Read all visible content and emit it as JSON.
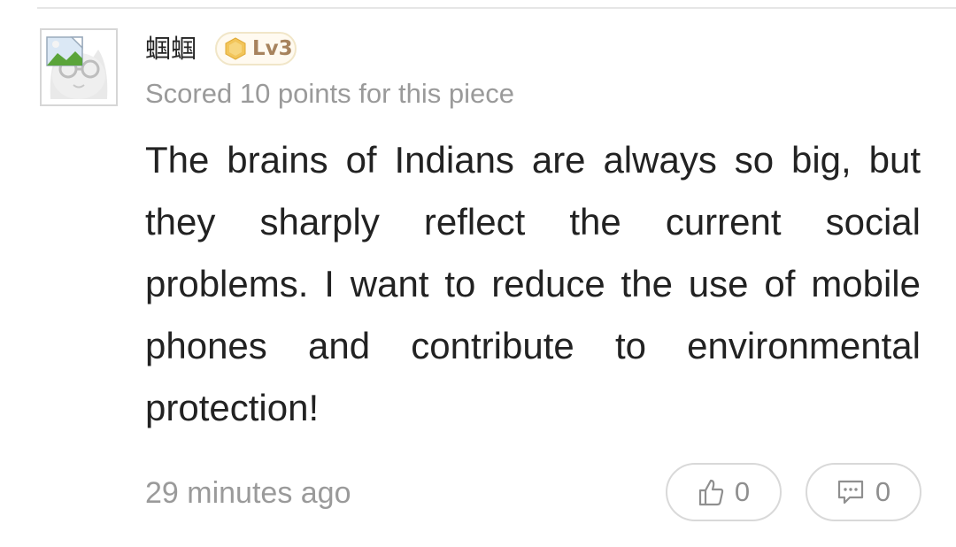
{
  "comment": {
    "username": "蝈蝈",
    "level": "Lv3",
    "score_note": "Scored 10 points for this piece",
    "body": "The brains of Indians are always so big, but they sharply reflect the current social problems. I want to reduce the use of mobile phones and contribute to environmental protection!",
    "timestamp": "29 minutes ago",
    "likes": "0",
    "replies": "0"
  },
  "icons": {
    "avatar": "cat-with-glasses-avatar",
    "level": "gold-hexagon-icon",
    "like": "thumbs-up-icon",
    "reply": "speech-bubble-icon"
  },
  "colors": {
    "text": "#222222",
    "muted": "#9a9a9a",
    "badge_text": "#a7835d",
    "badge_hex": "#f2c55a"
  }
}
